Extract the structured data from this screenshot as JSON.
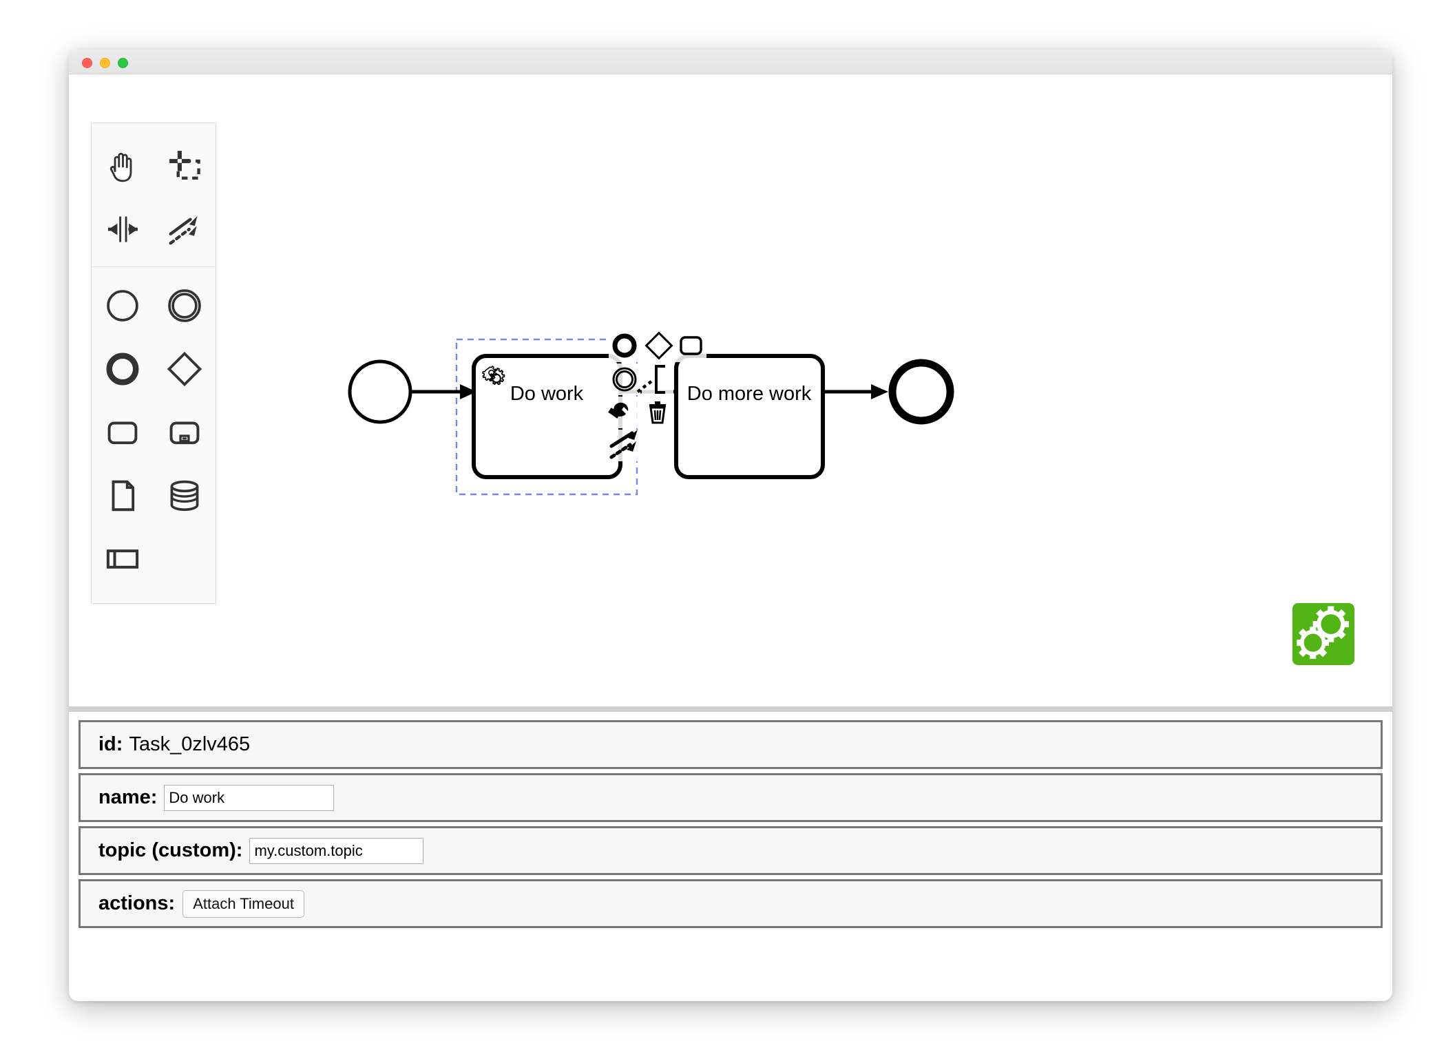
{
  "window": {
    "title": "",
    "traffic_lights": [
      {
        "name": "close",
        "color": "#ff5f57"
      },
      {
        "name": "minimize",
        "color": "#ffbd2e"
      },
      {
        "name": "zoom",
        "color": "#28c840"
      }
    ]
  },
  "palette": {
    "groups": [
      {
        "name": "tools",
        "items": [
          {
            "icon": "hand-tool-icon",
            "label": "Activate the hand tool"
          },
          {
            "icon": "lasso-tool-icon",
            "label": "Activate the lasso tool"
          },
          {
            "icon": "space-tool-icon",
            "label": "Activate the create/remove space tool"
          },
          {
            "icon": "global-connect-tool-icon",
            "label": "Activate the global connect tool"
          }
        ]
      },
      {
        "name": "elements",
        "items": [
          {
            "icon": "start-event-icon",
            "label": "Create StartEvent"
          },
          {
            "icon": "intermediate-event-icon",
            "label": "Create Intermediate/Boundary Event"
          },
          {
            "icon": "end-event-icon",
            "label": "Create EndEvent"
          },
          {
            "icon": "gateway-icon",
            "label": "Create Gateway"
          },
          {
            "icon": "task-icon",
            "label": "Create Task"
          },
          {
            "icon": "subprocess-icon",
            "label": "Create expanded SubProcess"
          },
          {
            "icon": "data-object-icon",
            "label": "Create DataObjectReference"
          },
          {
            "icon": "data-store-icon",
            "label": "Create DataStoreReference"
          },
          {
            "icon": "participant-icon",
            "label": "Create Pool/Participant"
          }
        ]
      }
    ]
  },
  "diagram": {
    "elements": [
      {
        "name": "start-event",
        "type": "startEvent",
        "label": ""
      },
      {
        "name": "task-do-work",
        "type": "serviceTask",
        "label": "Do work",
        "selected": true,
        "marker": "gear-icon"
      },
      {
        "name": "task-do-more-work",
        "type": "task",
        "label": "Do more work"
      },
      {
        "name": "end-event",
        "type": "endEvent",
        "label": ""
      }
    ],
    "connections": [
      {
        "name": "flow-start-to-do-work",
        "from": "start-event",
        "to": "task-do-work"
      },
      {
        "name": "flow-do-work-to-do-more-work",
        "from": "task-do-work",
        "to": "task-do-more-work"
      },
      {
        "name": "flow-do-more-work-to-end",
        "from": "task-do-more-work",
        "to": "end-event"
      }
    ],
    "selection_color": "#7b87e8"
  },
  "context_pad": {
    "target": "task-do-work",
    "actions": [
      {
        "icon": "append-end-event-icon",
        "label": "Append EndEvent"
      },
      {
        "icon": "append-gateway-icon",
        "label": "Append Gateway"
      },
      {
        "icon": "append-task-icon",
        "label": "Append Task"
      },
      {
        "icon": "append-intermediate-event-icon",
        "label": "Append Intermediate/Boundary Event"
      },
      {
        "icon": "append-text-annotation-icon",
        "label": "Append TextAnnotation"
      },
      {
        "icon": "change-type-wrench-icon",
        "label": "Change type"
      },
      {
        "icon": "delete-trash-icon",
        "label": "Remove"
      },
      {
        "icon": "connect-arrow-icon",
        "label": "Connect using Sequence/MessageFlow"
      }
    ]
  },
  "logo": {
    "name": "camunda-logo",
    "color": "#52b415"
  },
  "properties": {
    "rows": [
      {
        "name": "id-row",
        "label": "id:",
        "kind": "static",
        "value": "Task_0zlv465"
      },
      {
        "name": "name-row",
        "label": "name:",
        "kind": "input",
        "value": "Do work",
        "placeholder": ""
      },
      {
        "name": "topic-row",
        "label": "topic (custom):",
        "kind": "input",
        "value": "my.custom.topic",
        "placeholder": ""
      },
      {
        "name": "actions-row",
        "label": "actions:",
        "kind": "button",
        "value": "Attach Timeout"
      }
    ]
  }
}
